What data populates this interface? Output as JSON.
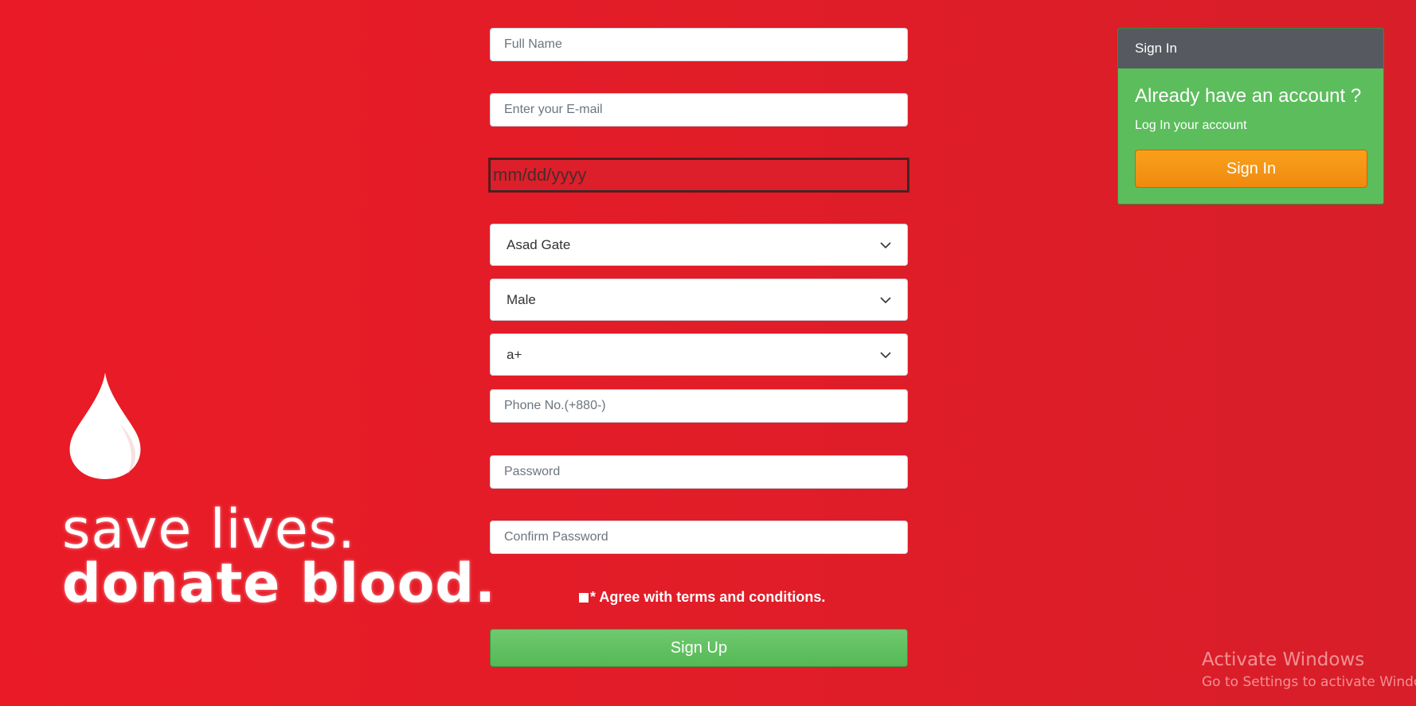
{
  "colors": {
    "background": "#e01d28",
    "panel_header": "#565a60",
    "panel_body": "#5cbd5c",
    "signin_button": "#f59414",
    "signup_button": "#5fbf5f"
  },
  "brand": {
    "logo_icon": "blood-drop",
    "slogan_line1": "save lives.",
    "slogan_line2": "donate blood."
  },
  "form": {
    "full_name_placeholder": "Full Name",
    "email_placeholder": "Enter your E-mail",
    "dob_placeholder": "mm/dd/yyyy",
    "location_selected": "Asad Gate",
    "gender_selected": "Male",
    "blood_group_selected": "a+",
    "phone_placeholder": "Phone No.(+880-)",
    "password_placeholder": "Password",
    "confirm_password_placeholder": "Confirm Password",
    "agree_label": "* Agree with terms and conditions.",
    "signup_label": "Sign Up"
  },
  "signin_panel": {
    "header": "Sign In",
    "title": "Already have an account ?",
    "subtitle": "Log In your account",
    "button_label": "Sign In"
  },
  "watermark": {
    "title": "Activate Windows",
    "subtitle": "Go to Settings to activate Windows."
  }
}
